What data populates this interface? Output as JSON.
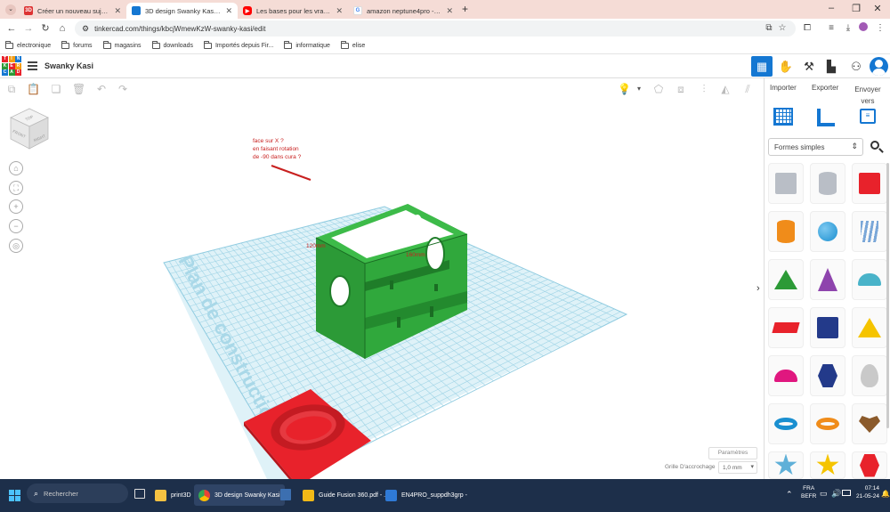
{
  "browser": {
    "tabs": [
      {
        "title": "Créer un nouveau sujet - Forum",
        "favicon": "3D",
        "active": false
      },
      {
        "title": "3D design Swanky Kasi - Tinkercad",
        "favicon": "tinkercad",
        "active": true
      },
      {
        "title": "Les bases pour les vrais débutants",
        "favicon": "youtube",
        "active": false
      },
      {
        "title": "amazon neptune4pro - Recherche",
        "favicon": "google",
        "active": false
      }
    ],
    "url": "tinkercad.com/things/kbcjWmewKzW-swanky-kasi/edit",
    "bookmarks": [
      "electronique",
      "forums",
      "magasins",
      "downloads",
      "Importés depuis Fir...",
      "informatique",
      "elise"
    ]
  },
  "app": {
    "logo_letters": [
      "TIN",
      "KER",
      "CAD"
    ],
    "design_title": "Swanky Kasi",
    "right_panel": {
      "import_label": "Importer",
      "export_label": "Exporter",
      "send_label": "Envoyer vers",
      "shape_category": "Formes simples"
    },
    "settings_label": "Paramètres",
    "snap_grid_label": "Grille D'accrochage",
    "snap_grid_value": "1,0 mm",
    "workplane_label": "Plan de construction"
  },
  "annotations": {
    "note_lines": [
      "face sur X ?",
      "en faisant rotation",
      "de -90 dans cura ?"
    ],
    "dim_120": "120mm",
    "dim_160": "160mm"
  },
  "viewcube": {
    "top": "TOP",
    "front": "FRONT",
    "right": "RIGHT"
  },
  "taskbar": {
    "search_placeholder": "Rechercher",
    "apps": [
      {
        "label": "print3D",
        "active": false
      },
      {
        "label": "3D design Swanky Kasi",
        "active": true
      },
      {
        "label": "Guide Fusion 360.pdf - ...",
        "active": false
      },
      {
        "label": "EN4PRO_suppdh3grp -",
        "active": false
      }
    ],
    "lang_top": "FRA",
    "lang_bottom": "BEFR",
    "time": "07:14",
    "date": "21-05-24"
  },
  "colors": {
    "tabstrip": "#f5dcd6",
    "accent_blue": "#1477d2",
    "box_green": "#2c9a37",
    "plate_red": "#e8222b",
    "grid_blue": "#bfe4f0",
    "annotation_red": "#c8201f"
  }
}
